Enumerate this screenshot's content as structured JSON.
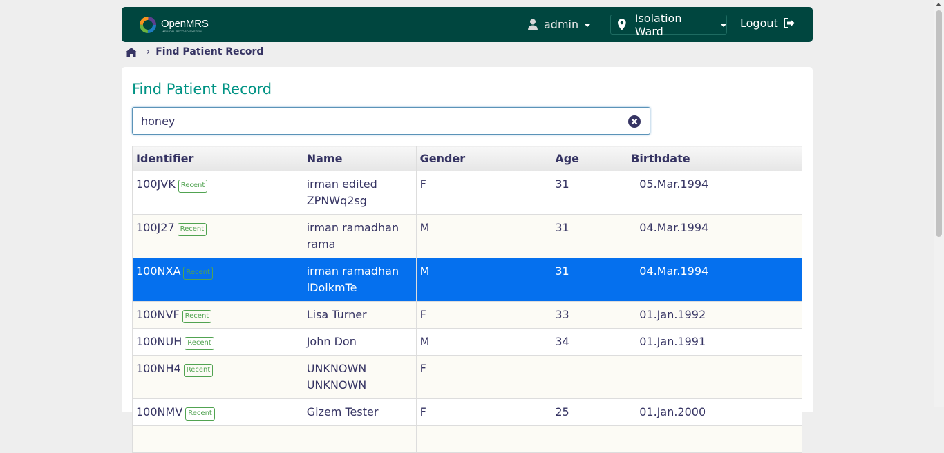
{
  "header": {
    "logo_text": "OpenMRS",
    "logo_subtext": "MEDICAL RECORD SYSTEM",
    "user_icon": "user-icon",
    "user_name": "admin",
    "location_icon": "map-marker-icon",
    "location_name": "Isolation Ward",
    "logout_label": "Logout",
    "logout_icon": "sign-out-icon",
    "colors": {
      "background": "#00463f",
      "logo_orange": "#f7931e",
      "logo_blue": "#1d7bbf",
      "logo_green": "#6cb33f",
      "logo_purple": "#5b3f8f"
    }
  },
  "breadcrumb": {
    "home_icon": "home-icon",
    "separator_icon": "chevron-right-icon",
    "current": "Find Patient Record"
  },
  "page": {
    "title": "Find Patient Record",
    "title_color": "#009384"
  },
  "search": {
    "value": "honey",
    "clear_icon": "times-circle-icon"
  },
  "results": {
    "columns": [
      "Identifier",
      "Name",
      "Gender",
      "Age",
      "Birthdate"
    ],
    "badge_label": "Recent",
    "selected_color": "#0570ee",
    "rows": [
      {
        "identifier": "100JVK",
        "name_line1": "irman edited",
        "name_line2": "ZPNWq2sg",
        "gender": "F",
        "age": "31",
        "birthdate": "05.Mar.1994"
      },
      {
        "identifier": "100J27",
        "name_line1": "irman ramadhan",
        "name_line2": "rama",
        "gender": "M",
        "age": "31",
        "birthdate": "04.Mar.1994"
      },
      {
        "identifier": "100NXA",
        "name_line1": "irman ramadhan",
        "name_line2": "lDoikmTe",
        "gender": "M",
        "age": "31",
        "birthdate": "04.Mar.1994"
      },
      {
        "identifier": "100NVF",
        "name_line1": "Lisa Turner",
        "name_line2": "",
        "gender": "F",
        "age": "33",
        "birthdate": "01.Jan.1992"
      },
      {
        "identifier": "100NUH",
        "name_line1": "John Don",
        "name_line2": "",
        "gender": "M",
        "age": "34",
        "birthdate": "01.Jan.1991"
      },
      {
        "identifier": "100NH4",
        "name_line1": "UNKNOWN",
        "name_line2": "UNKNOWN",
        "gender": "F",
        "age": "",
        "birthdate": ""
      },
      {
        "identifier": "100NMV",
        "name_line1": "Gizem Tester",
        "name_line2": "",
        "gender": "F",
        "age": "25",
        "birthdate": "01.Jan.2000"
      }
    ]
  }
}
